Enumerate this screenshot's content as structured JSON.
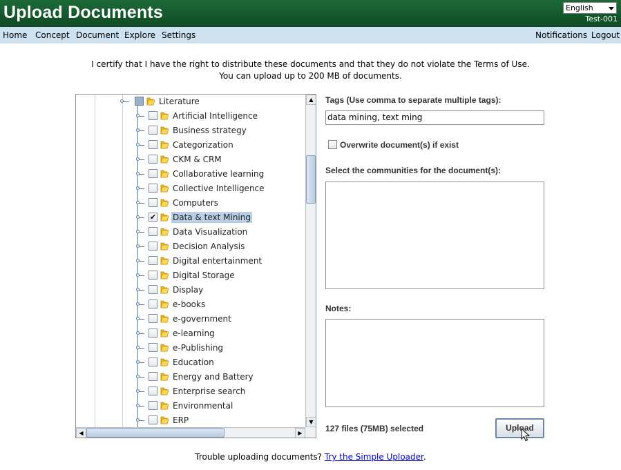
{
  "header": {
    "title": "Upload Documents",
    "language": "English",
    "user": "Test-001"
  },
  "nav": {
    "left": [
      "Home",
      "Concept",
      "Document",
      "Explore",
      "Settings"
    ],
    "right": [
      "Notifications",
      "Logout"
    ]
  },
  "certify": {
    "line1": "I certify that I have the right to distribute these documents and that they do not violate the Terms of Use.",
    "line2": "You can upload up to 200 MB of documents."
  },
  "tree": {
    "root": {
      "label": "Literature",
      "state": "partial"
    },
    "items": [
      {
        "label": "Artificial Intelligence",
        "checked": false
      },
      {
        "label": "Business strategy",
        "checked": false
      },
      {
        "label": "Categorization",
        "checked": false
      },
      {
        "label": "CKM & CRM",
        "checked": false
      },
      {
        "label": "Collaborative learning",
        "checked": false
      },
      {
        "label": "Collective Intelligence",
        "checked": false
      },
      {
        "label": "Computers",
        "checked": false
      },
      {
        "label": "Data & text Mining",
        "checked": true,
        "selected": true
      },
      {
        "label": "Data Visualization",
        "checked": false
      },
      {
        "label": "Decision Analysis",
        "checked": false
      },
      {
        "label": "Digital entertainment",
        "checked": false
      },
      {
        "label": "Digital Storage",
        "checked": false
      },
      {
        "label": "Display",
        "checked": false
      },
      {
        "label": "e-books",
        "checked": false
      },
      {
        "label": "e-government",
        "checked": false
      },
      {
        "label": "e-learning",
        "checked": false
      },
      {
        "label": "e-Publishing",
        "checked": false
      },
      {
        "label": "Education",
        "checked": false
      },
      {
        "label": "Energy and Battery",
        "checked": false
      },
      {
        "label": "Enterprise search",
        "checked": false
      },
      {
        "label": "Environmental",
        "checked": false
      },
      {
        "label": "ERP",
        "checked": false
      }
    ]
  },
  "form": {
    "tags_label": "Tags (Use comma to separate multiple tags):",
    "tags_value": "data mining, text ming",
    "overwrite_label": "Overwrite document(s) if exist",
    "communities_label": "Select the communities for the document(s):",
    "notes_label": "Notes:",
    "files_selected": "127 files (75MB) selected",
    "upload_label": "Upload"
  },
  "footer": {
    "text": "Trouble uploading documents?",
    "link": "Try the Simple Uploader",
    "suffix": "."
  },
  "colors": {
    "header_bg": "#1d6a38",
    "nav_bg": "#cde1f0",
    "selection": "#b8cfe5",
    "link": "#0000cc"
  }
}
